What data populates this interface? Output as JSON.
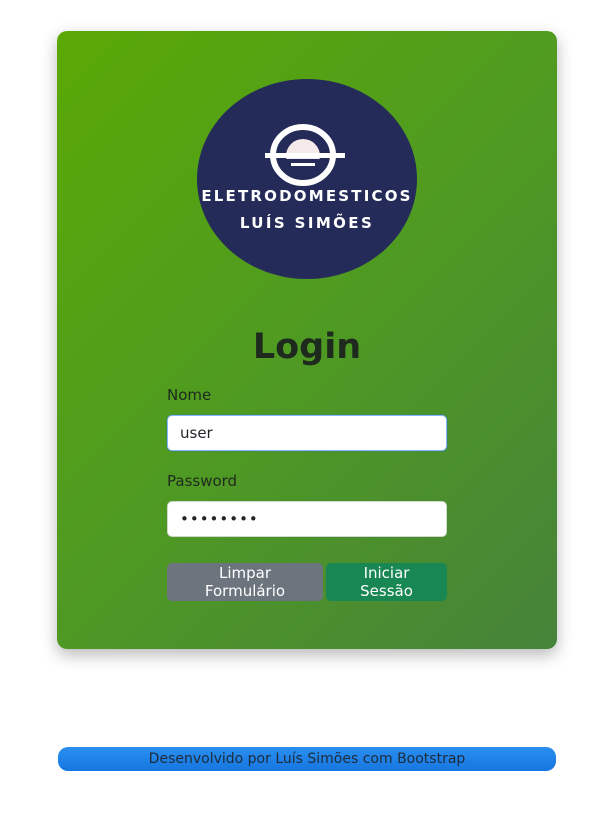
{
  "logo": {
    "line1": "ELETRODOMESTICOS",
    "line2": "LUÍS SIMÕES",
    "icon": "appliance-logo-icon",
    "colors": {
      "circle": "#252b58",
      "mark": "#ffffff"
    }
  },
  "form": {
    "title": "Login",
    "name_label": "Nome",
    "name_value": "user",
    "password_label": "Password",
    "password_value": "••••••••",
    "clear_button": "Limpar Formulário",
    "submit_button": "Iniciar Sessão"
  },
  "footer": {
    "text": "Desenvolvido por Luís Simões com Bootstrap"
  },
  "colors": {
    "card_gradient_start": "#5aa905",
    "card_gradient_end": "#46833a",
    "clear_button": "#6c757d",
    "submit_button": "#198754",
    "footer": "#1677e0"
  }
}
